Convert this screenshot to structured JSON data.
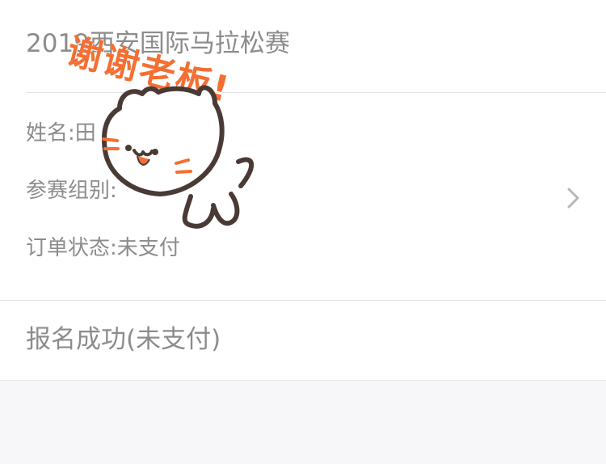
{
  "event": {
    "title": "2019西安国际马拉松赛"
  },
  "order": {
    "name_text": "姓名:田",
    "group_text": "参赛组别:",
    "status_text": "订单状态:未支付"
  },
  "registration": {
    "status_text": "报名成功(未支付)"
  },
  "sticker": {
    "caption": "谢谢老板!"
  },
  "icons": {
    "detail_arrow": "chevron-right-icon",
    "sticker_character": "white-cat-sticker"
  },
  "colors": {
    "text_gray": "#8c8c8c",
    "sticker_orange": "#f46f33",
    "background": "#f7f7f9"
  }
}
